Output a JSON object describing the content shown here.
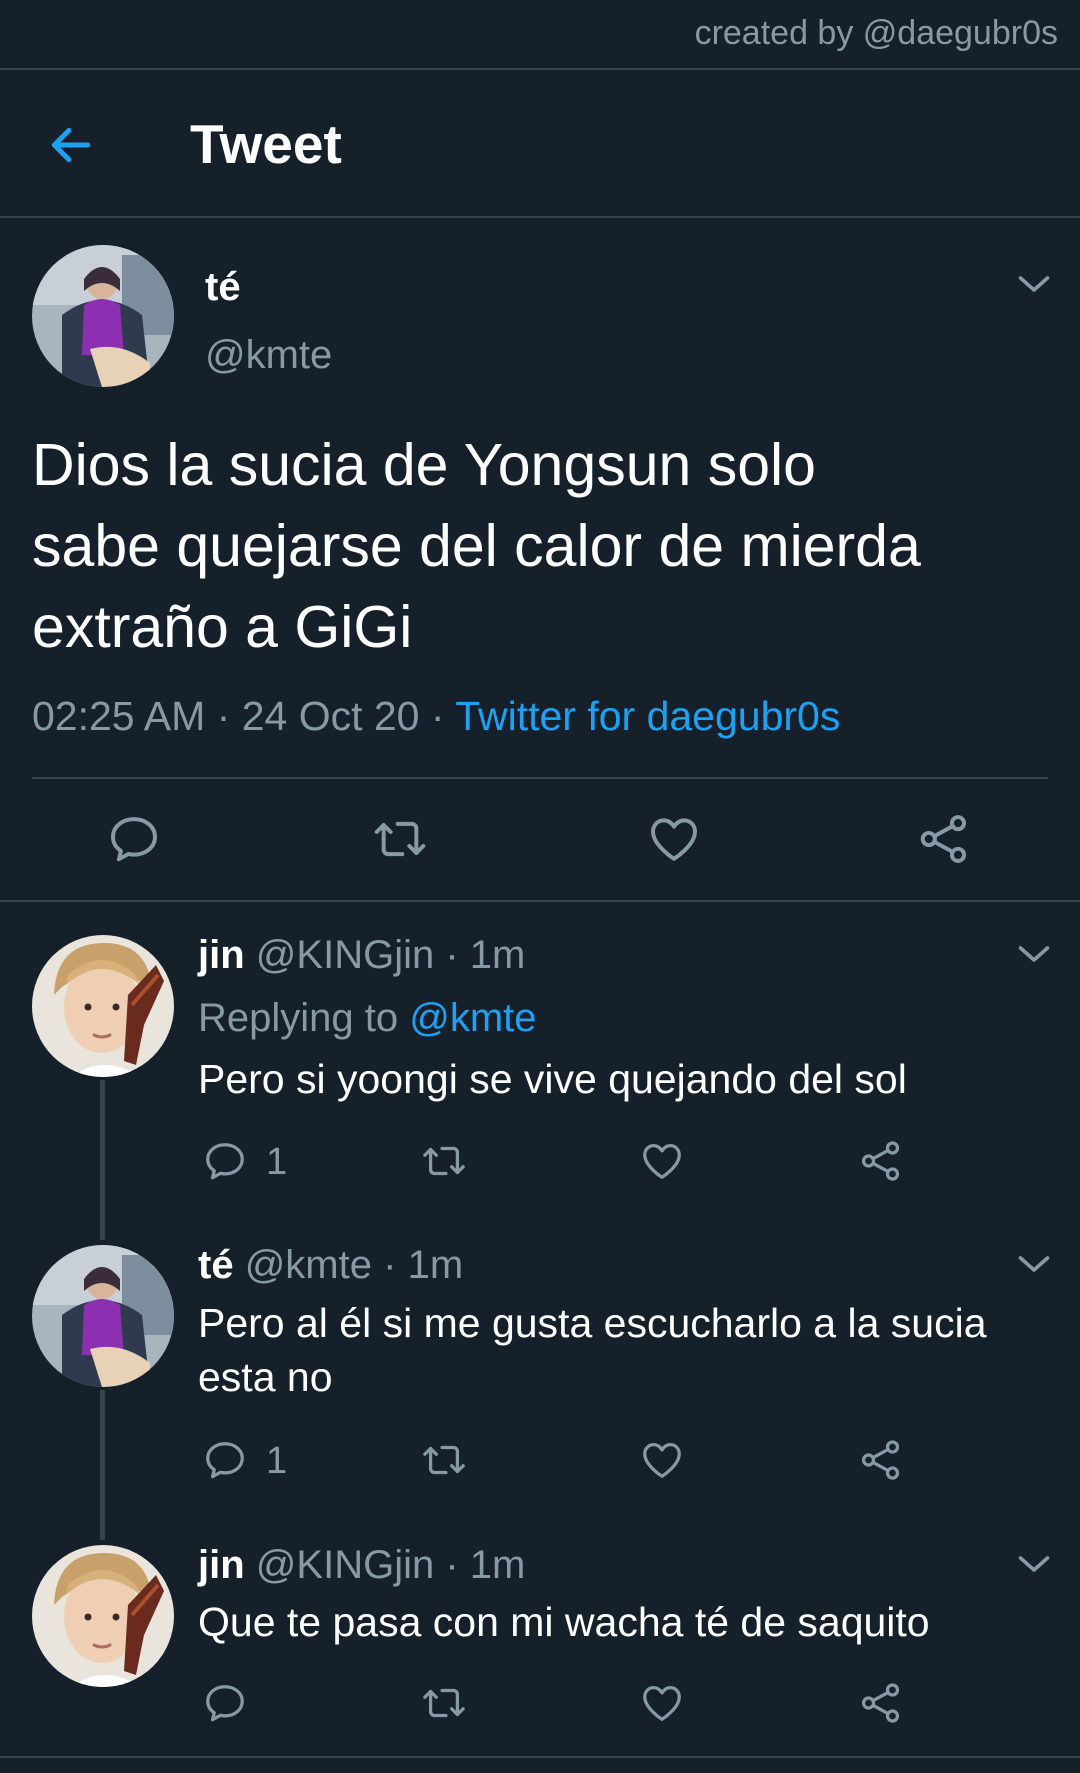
{
  "watermark": "created by @daegubr0s",
  "header": {
    "title": "Tweet",
    "back_icon": "arrow-left-icon"
  },
  "colors": {
    "background": "#15202b",
    "divider": "#38444d",
    "muted": "#8899a6",
    "accent": "#1da1f2"
  },
  "main_tweet": {
    "name": "té",
    "handle": "@kmte",
    "text": "Dios la sucia de Yongsun solo\nsabe quejarse del calor de mierda\nextraño a GiGi",
    "time": "02:25 AM",
    "date": "24 Oct 20",
    "separator": "·",
    "source": "Twitter for daegubr0s",
    "actions": [
      "reply-icon",
      "retweet-icon",
      "like-icon",
      "share-icon"
    ]
  },
  "replies": [
    {
      "name": "jin",
      "handle": "@KINGjin",
      "time": "1m",
      "replying_label": "Replying to",
      "replying_to": "@kmte",
      "text": "Pero si yoongi se vive quejando del sol",
      "reply_count": "1"
    },
    {
      "name": "té",
      "handle": "@kmte",
      "time": "1m",
      "text": "Pero al él si me gusta escucharlo a la sucia\nesta no",
      "reply_count": "1"
    },
    {
      "name": "jin",
      "handle": "@KINGjin",
      "time": "1m",
      "text": "Que te pasa con mi wacha té de saquito"
    }
  ]
}
